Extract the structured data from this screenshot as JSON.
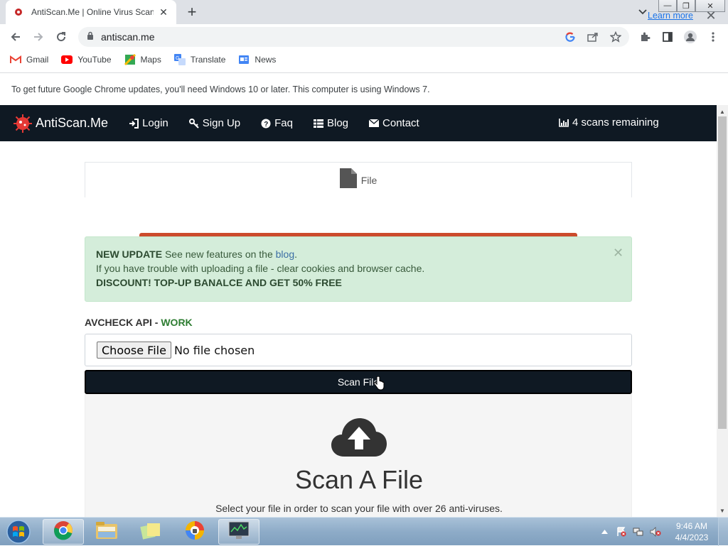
{
  "browser": {
    "tab_title": "AntiScan.Me | Online Virus Scanner",
    "address": "antiscan.me",
    "bookmarks": [
      {
        "label": "Gmail",
        "icon": "gmail-icon"
      },
      {
        "label": "YouTube",
        "icon": "youtube-icon"
      },
      {
        "label": "Maps",
        "icon": "maps-icon"
      },
      {
        "label": "Translate",
        "icon": "translate-icon"
      },
      {
        "label": "News",
        "icon": "news-icon"
      }
    ],
    "infobar": {
      "message": "To get future Google Chrome updates, you'll need Windows 10 or later. This computer is using Windows 7.",
      "link": "Learn more"
    }
  },
  "site": {
    "brand": "AntiScan.Me",
    "nav": [
      {
        "label": "Login",
        "icon": "login-icon"
      },
      {
        "label": "Sign Up",
        "icon": "key-icon"
      },
      {
        "label": "Faq",
        "icon": "question-icon"
      },
      {
        "label": "Blog",
        "icon": "list-icon"
      },
      {
        "label": "Contact",
        "icon": "envelope-icon"
      }
    ],
    "scans_remaining": "4 scans remaining",
    "file_tab": "File",
    "alert": {
      "update_label": "NEW UPDATE",
      "update_text": " See new features on the ",
      "blog_link": "blog",
      "blog_tail": ".",
      "line2": "If you have trouble with uploading a file - clear cookies and browser cache.",
      "line3": "DISCOUNT! TOP-UP BANALCE AND GET 50% FREE"
    },
    "api_label": "AVCHECK API - ",
    "api_status": "WORK",
    "choose_file": "Choose File",
    "no_file": "No file chosen",
    "scan_button": "Scan File",
    "dropzone_title": "Scan A File",
    "dropzone_sub": "Select your file in order to scan your file with over 26 anti-viruses."
  },
  "taskbar": {
    "time": "9:46 AM",
    "date": "4/4/2023"
  },
  "colors": {
    "site_nav": "#0f1923",
    "alert_bg": "#d4edda",
    "accent_line": "#cc4b2c",
    "api_work": "#2e7d32"
  }
}
